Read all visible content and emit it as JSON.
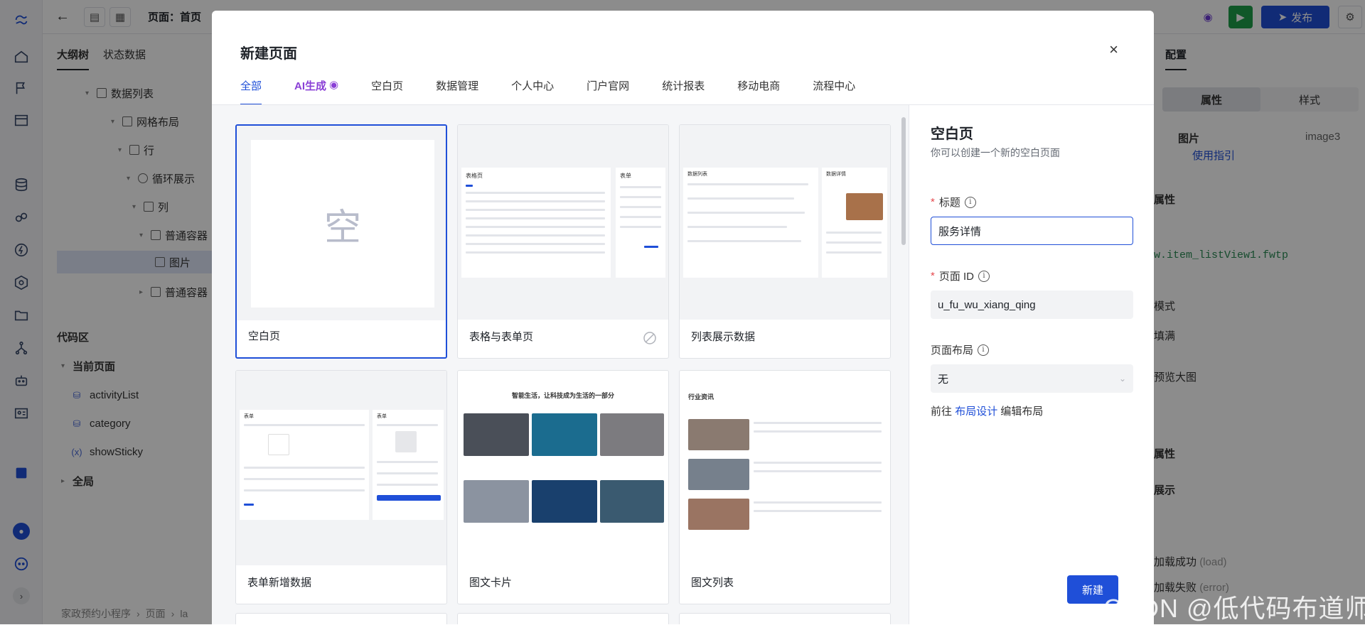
{
  "topbar": {
    "page_selector": "页面：首页",
    "publish_label": "发布"
  },
  "left_panel": {
    "tabs": [
      "大纲树",
      "状态数据"
    ],
    "tree": [
      "数据列表",
      "网格布局",
      "行",
      "循环展示",
      "列",
      "普通容器",
      "图片",
      "普通容器"
    ],
    "code_section": "代码区",
    "current_page": "当前页面",
    "code_items": [
      "activityList",
      "category",
      "showSticky"
    ],
    "global": "全局",
    "breadcrumb": [
      "家政预约小程序",
      "页面",
      "la"
    ]
  },
  "right_panel": {
    "title": "配置",
    "seg": [
      "属性",
      "样式"
    ],
    "component_name": "图片",
    "component_id": "image3",
    "guide_link": "使用指引",
    "rows": [
      "属性",
      "w.item_listView1.fwtp",
      "模式",
      "填满",
      "预览大图",
      "属性",
      "展示",
      "加载成功",
      "(load)",
      "加载失败",
      "(error)"
    ]
  },
  "modal": {
    "title": "新建页面",
    "close": "×",
    "tabs": [
      "全部",
      "AI生成",
      "空白页",
      "数据管理",
      "个人中心",
      "门户官网",
      "统计报表",
      "移动电商",
      "流程中心"
    ],
    "cards": [
      {
        "label": "空白页",
        "thumb_text": "空"
      },
      {
        "label": "表格与表单页",
        "thumb_left_title": "表格页",
        "thumb_right_title": "表单"
      },
      {
        "label": "列表展示数据",
        "thumb_title": "数据列表",
        "thumb_side_title": "数据详情"
      },
      {
        "label": "表单新增数据",
        "thumb_left_title": "表单",
        "thumb_right_title": "表单"
      },
      {
        "label": "图文卡片",
        "thumb_title": "智能生活，让科技成为生活的一部分"
      },
      {
        "label": "图文列表",
        "thumb_title": "行业资讯"
      }
    ],
    "form": {
      "title": "空白页",
      "desc": "你可以创建一个新的空白页面",
      "title_label": "标题",
      "title_value": "服务详情",
      "id_label": "页面 ID",
      "id_value": "u_fu_wu_xiang_qing",
      "layout_label": "页面布局",
      "layout_value": "无",
      "link_prefix": "前往",
      "link_text": "布局设计",
      "link_suffix": "编辑布局",
      "create_button": "新建"
    }
  },
  "watermark": "CSDN @低代码布道师",
  "colors": {
    "primary": "#1f4fd8",
    "run": "#1e9e4a",
    "ai": "#8a3fd6"
  }
}
